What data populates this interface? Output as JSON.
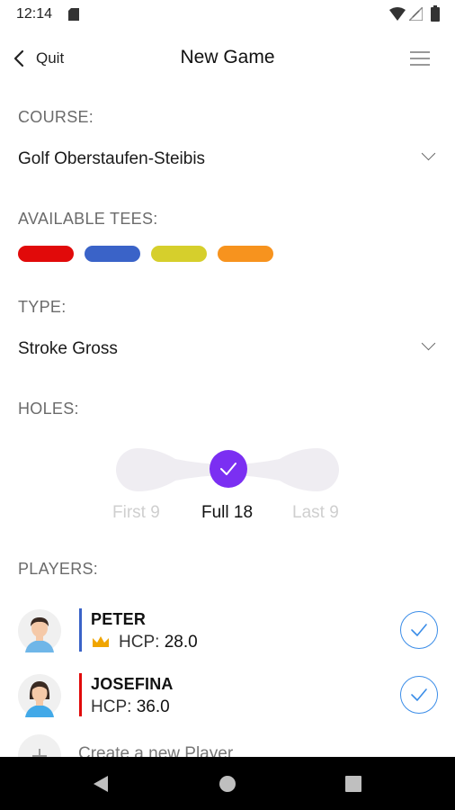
{
  "status_bar": {
    "time": "12:14"
  },
  "header": {
    "back_label": "Quit",
    "title": "New Game"
  },
  "course": {
    "label": "COURSE:",
    "value": "Golf Oberstaufen-Steibis"
  },
  "tees": {
    "label": "AVAILABLE TEES:",
    "colors": [
      "#e10a0a",
      "#3a63c8",
      "#d6cf2c",
      "#f7931e"
    ]
  },
  "type": {
    "label": "TYPE:",
    "value": "Stroke Gross"
  },
  "holes": {
    "label": "HOLES:",
    "options": [
      "First 9",
      "Full 18",
      "Last 9"
    ],
    "selected": "Full 18",
    "accent": "#7b2ff2"
  },
  "players": {
    "label": "PLAYERS:",
    "items": [
      {
        "name": "PETER",
        "hcp_label": "HCP:",
        "hcp": "28.0",
        "bar_color": "#3a63c8",
        "crown": true
      },
      {
        "name": "JOSEFINA",
        "hcp_label": "HCP:",
        "hcp": "36.0",
        "bar_color": "#e10a0a",
        "crown": false
      }
    ],
    "create_label": "Create a new Player"
  },
  "colors": {
    "accent": "#7b2ff2",
    "check": "#3b8de8",
    "crown": "#f0a500"
  }
}
